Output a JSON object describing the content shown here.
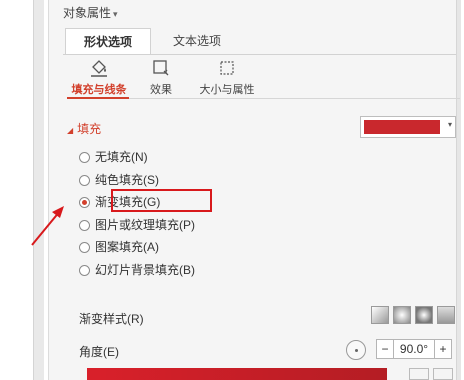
{
  "panel": {
    "title": "对象属性"
  },
  "tabs": [
    {
      "label": "形状选项",
      "active": true
    },
    {
      "label": "文本选项",
      "active": false
    }
  ],
  "subtabs": [
    {
      "label": "填充与线条",
      "icon": "paint-bucket-icon",
      "active": true
    },
    {
      "label": "效果",
      "icon": "effects-icon",
      "active": false
    },
    {
      "label": "大小与属性",
      "icon": "size-properties-icon",
      "active": false
    }
  ],
  "fill": {
    "header": "填充",
    "color_swatch": "#c9282d",
    "options": [
      {
        "label": "无填充(N)",
        "selected": false
      },
      {
        "label": "纯色填充(S)",
        "selected": false
      },
      {
        "label": "渐变填充(G)",
        "selected": true
      },
      {
        "label": "图片或纹理填充(P)",
        "selected": false
      },
      {
        "label": "图案填充(A)",
        "selected": false
      },
      {
        "label": "幻灯片背景填充(B)",
        "selected": false
      }
    ]
  },
  "gradient": {
    "style_label": "渐变样式(R)",
    "angle_label": "角度(E)",
    "angle_value": "90.0°",
    "minus": "−",
    "plus": "+"
  },
  "colors": {
    "accent": "#d2402c",
    "highlight": "#d8191c"
  }
}
